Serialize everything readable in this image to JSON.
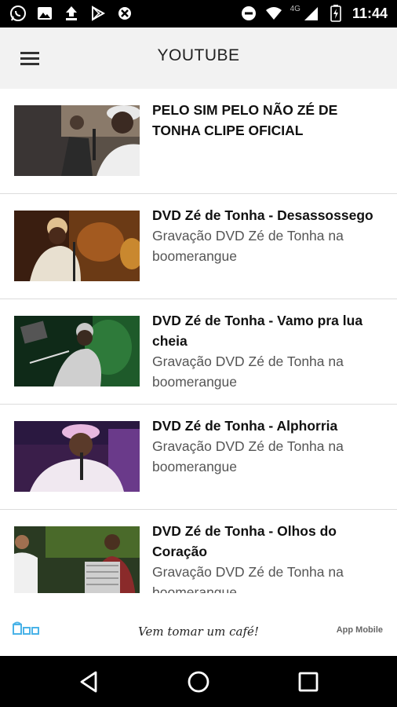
{
  "status_bar": {
    "time": "11:44",
    "network": "4G",
    "left_icons": [
      "whatsapp-icon",
      "image-icon",
      "upload-icon",
      "play-store-icon",
      "app-notification-icon"
    ],
    "right_icons": [
      "do-not-disturb-icon",
      "wifi-icon",
      "signal-icon",
      "battery-icon"
    ]
  },
  "app_bar": {
    "title": "YOUTUBE",
    "menu_icon": "hamburger-menu-icon"
  },
  "videos": [
    {
      "title": "PELO SIM PELO NÃO ZÉ DE TONHA CLIPE OFICIAL",
      "description": ""
    },
    {
      "title": "DVD Zé de Tonha - Desassossego",
      "description": "Gravação DVD Zé de Tonha na boomerangue"
    },
    {
      "title": "DVD Zé de Tonha - Vamo pra lua cheia",
      "description": "Gravação DVD Zé de Tonha na boomerangue"
    },
    {
      "title": "DVD Zé de Tonha - Alphorria",
      "description": "Gravação DVD Zé de Tonha na boomerangue"
    },
    {
      "title": "DVD Zé de Tonha - Olhos do Coração",
      "description": "Gravação DVD Zé de Tonha na boomerangue"
    }
  ],
  "ad_banner": {
    "slogan": "Vem tomar um café!",
    "brand": "App Mobile"
  },
  "nav_bar": {
    "back": "back-icon",
    "home": "home-icon",
    "recents": "recents-icon"
  },
  "colors": {
    "status_bar_bg": "#000000",
    "app_bar_bg": "#f2f2f2",
    "divider": "#dcdcdc",
    "ad_logo_accent": "#4ab3e8"
  }
}
